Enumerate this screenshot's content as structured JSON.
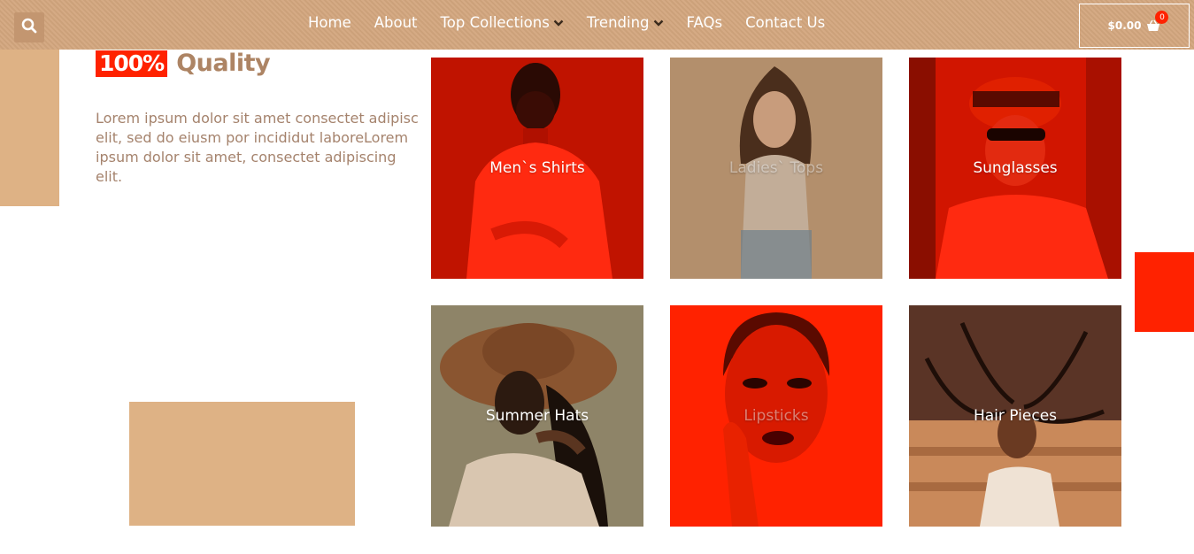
{
  "header": {
    "nav": [
      {
        "label": "Home",
        "dropdown": false
      },
      {
        "label": "About",
        "dropdown": false
      },
      {
        "label": "Top Collections",
        "dropdown": true
      },
      {
        "label": "Trending",
        "dropdown": true
      },
      {
        "label": "FAQs",
        "dropdown": false
      },
      {
        "label": "Contact Us",
        "dropdown": false
      }
    ],
    "cart": {
      "amount": "$0.00",
      "count": "0",
      "icon": "shopping-basket-icon"
    },
    "search_icon": "search-icon"
  },
  "intro": {
    "badge": "100%",
    "title": "Quality",
    "description": "Lorem ipsum dolor sit amet consectet adipisc elit, sed do eiusm por incididut laboreLorem ipsum dolor sit amet, consectet adipiscing elit."
  },
  "tiles": [
    {
      "label": "Men`s Shirts"
    },
    {
      "label": "Ladies` Tops"
    },
    {
      "label": "Sunglasses"
    },
    {
      "label": "Summer Hats"
    },
    {
      "label": "Lipsticks"
    },
    {
      "label": "Hair Pieces"
    }
  ],
  "colors": {
    "header": "#d3a67e",
    "accent_red": "#ff2200",
    "tan": "#deb285",
    "text_brown": "#ad8464"
  }
}
